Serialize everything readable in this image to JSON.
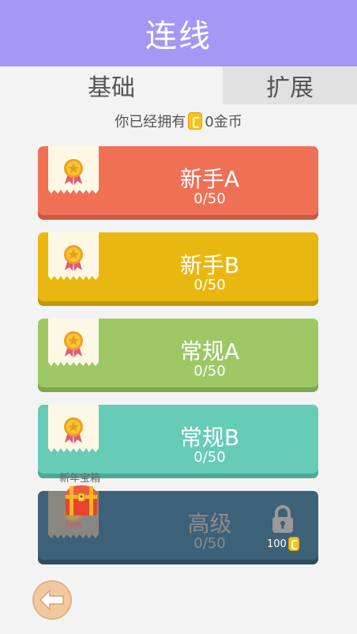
{
  "header": {
    "title": "连线"
  },
  "tabs": [
    {
      "label": "基础",
      "active": true
    },
    {
      "label": "扩展",
      "active": false
    }
  ],
  "coins": {
    "prefix": "你已经拥有",
    "amount_text": "0金币"
  },
  "levels": [
    {
      "name": "新手A",
      "progress": "0/50",
      "color": "#f07055",
      "shade": "#c85a45",
      "locked": false
    },
    {
      "name": "新手B",
      "progress": "0/50",
      "color": "#e8b810",
      "shade": "#c0970a",
      "locked": false
    },
    {
      "name": "常规A",
      "progress": "0/50",
      "color": "#9dc865",
      "shade": "#7ea64c",
      "locked": false
    },
    {
      "name": "常规B",
      "progress": "0/50",
      "color": "#66ccb8",
      "shade": "#4ea996",
      "locked": false
    },
    {
      "name": "高级",
      "progress": "0/50",
      "color": "#3d6179",
      "shade": "#2e4b5f",
      "locked": true,
      "price": "100"
    }
  ],
  "chest": {
    "label": "新年宝箱"
  },
  "icons": {
    "coin": "coin-icon",
    "medal": "medal-icon",
    "lock": "lock-icon",
    "chest": "treasure-chest-icon",
    "back": "back-arrow-icon"
  }
}
